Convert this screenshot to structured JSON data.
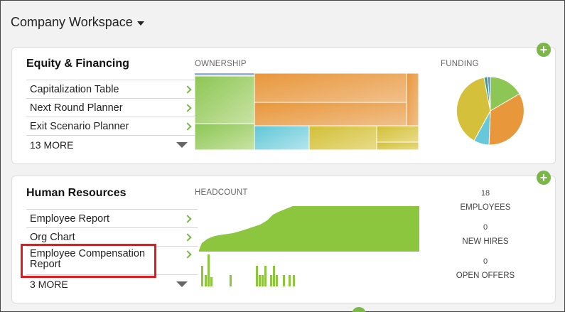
{
  "workspace": {
    "title": "Company Workspace"
  },
  "equity": {
    "title": "Equity & Financing",
    "links": [
      "Capitalization Table",
      "Next Round Planner",
      "Exit Scenario Planner"
    ],
    "more_label": "13 MORE",
    "ownership_label": "OWNERSHIP",
    "funding_label": "FUNDING"
  },
  "hr": {
    "title": "Human Resources",
    "links": [
      "Employee Report",
      "Org Chart",
      "Employee Compensation Report"
    ],
    "more_label": "3 MORE",
    "headcount_label": "HEADCOUNT",
    "stats": [
      {
        "value": "18",
        "label": "EMPLOYEES"
      },
      {
        "value": "0",
        "label": "NEW HIRES"
      },
      {
        "value": "0",
        "label": "OPEN OFFERS"
      }
    ]
  },
  "icons": {
    "add": "+",
    "expand": "caret-down-icon",
    "chevron": "chevron-right-icon"
  },
  "colors": {
    "accent_green": "#7ab648",
    "orange": "#e89a3c",
    "yellow": "#d4c03a",
    "teal": "#66c8d8",
    "highlight_red": "#e01b1b"
  }
}
